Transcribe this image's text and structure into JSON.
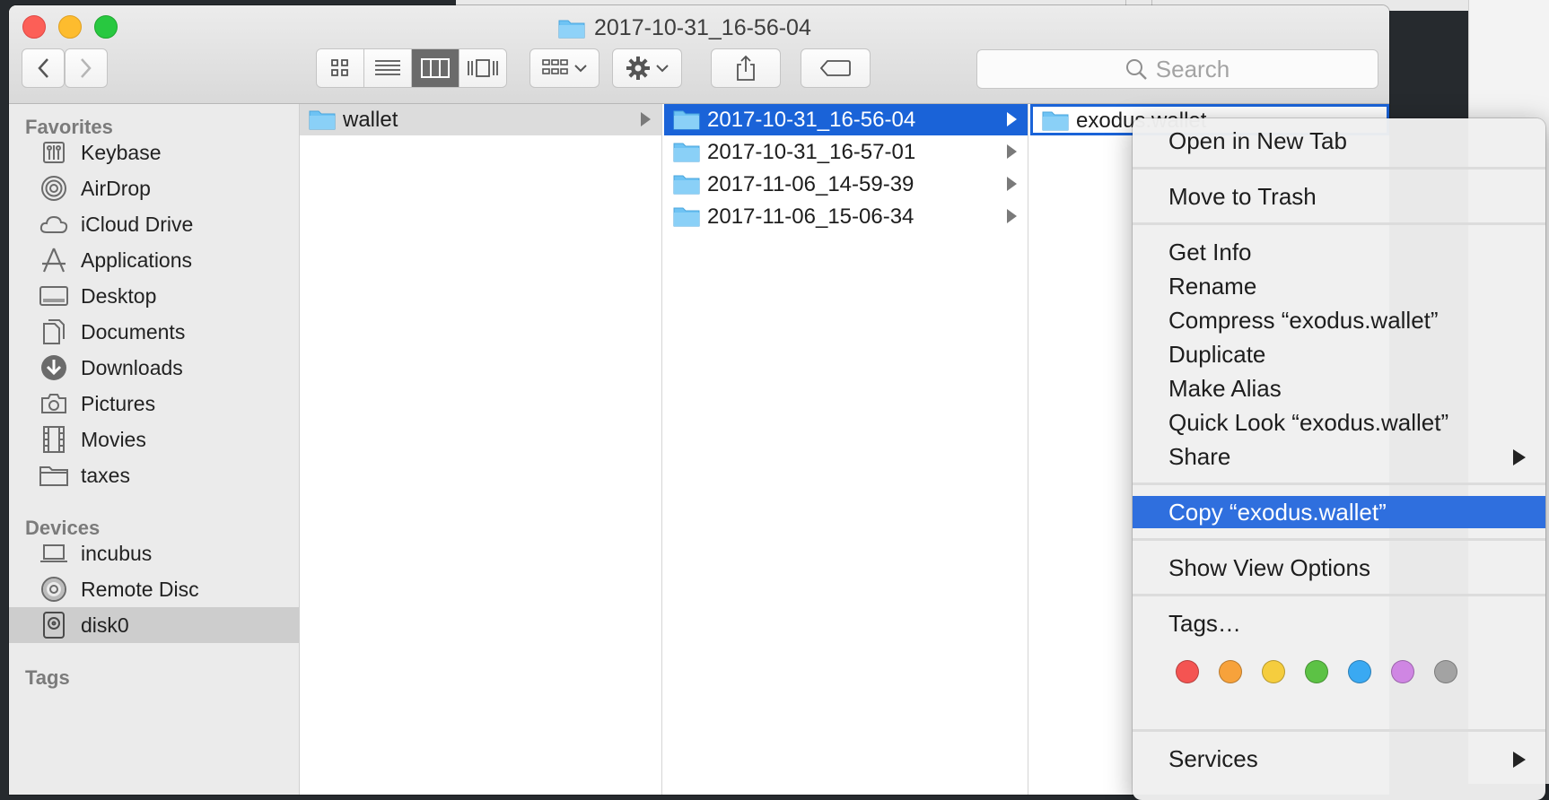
{
  "window": {
    "title": "2017-10-31_16-56-04"
  },
  "toolbar": {
    "views": [
      "icon-view",
      "list-view",
      "column-view",
      "cover-flow-view"
    ],
    "active_view": "column-view",
    "search_placeholder": "Search"
  },
  "sidebar": {
    "favorites_heading": "Favorites",
    "favorites": [
      {
        "label": "Keybase",
        "icon": "keybase-icon"
      },
      {
        "label": "AirDrop",
        "icon": "airdrop-icon"
      },
      {
        "label": "iCloud Drive",
        "icon": "cloud-icon"
      },
      {
        "label": "Applications",
        "icon": "applications-icon"
      },
      {
        "label": "Desktop",
        "icon": "desktop-icon"
      },
      {
        "label": "Documents",
        "icon": "documents-icon"
      },
      {
        "label": "Downloads",
        "icon": "downloads-icon"
      },
      {
        "label": "Pictures",
        "icon": "camera-icon"
      },
      {
        "label": "Movies",
        "icon": "film-icon"
      },
      {
        "label": "taxes",
        "icon": "folder-icon"
      }
    ],
    "devices_heading": "Devices",
    "devices": [
      {
        "label": "incubus",
        "icon": "laptop-icon"
      },
      {
        "label": "Remote Disc",
        "icon": "disc-icon"
      },
      {
        "label": "disk0",
        "icon": "hard-drive-icon",
        "selected": true
      }
    ],
    "tags_heading": "Tags"
  },
  "columns": {
    "col1": [
      {
        "label": "wallet"
      }
    ],
    "col2": [
      {
        "label": "2017-10-31_16-56-04"
      },
      {
        "label": "2017-10-31_16-57-01"
      },
      {
        "label": "2017-11-06_14-59-39"
      },
      {
        "label": "2017-11-06_15-06-34"
      }
    ],
    "col3": [
      {
        "label": "exodus.wallet"
      }
    ]
  },
  "context_menu": {
    "open_new_tab": "Open in New Tab",
    "move_to_trash": "Move to Trash",
    "get_info": "Get Info",
    "rename": "Rename",
    "compress": "Compress “exodus.wallet”",
    "duplicate": "Duplicate",
    "make_alias": "Make Alias",
    "quick_look": "Quick Look “exodus.wallet”",
    "share": "Share",
    "copy": "Copy “exodus.wallet”",
    "show_view_options": "Show View Options",
    "tags": "Tags…",
    "services": "Services",
    "tag_colors": [
      "#f45452",
      "#f7a23b",
      "#f5cd3e",
      "#5cc245",
      "#3aa9f2",
      "#cf86e3",
      "#a3a3a3"
    ]
  }
}
